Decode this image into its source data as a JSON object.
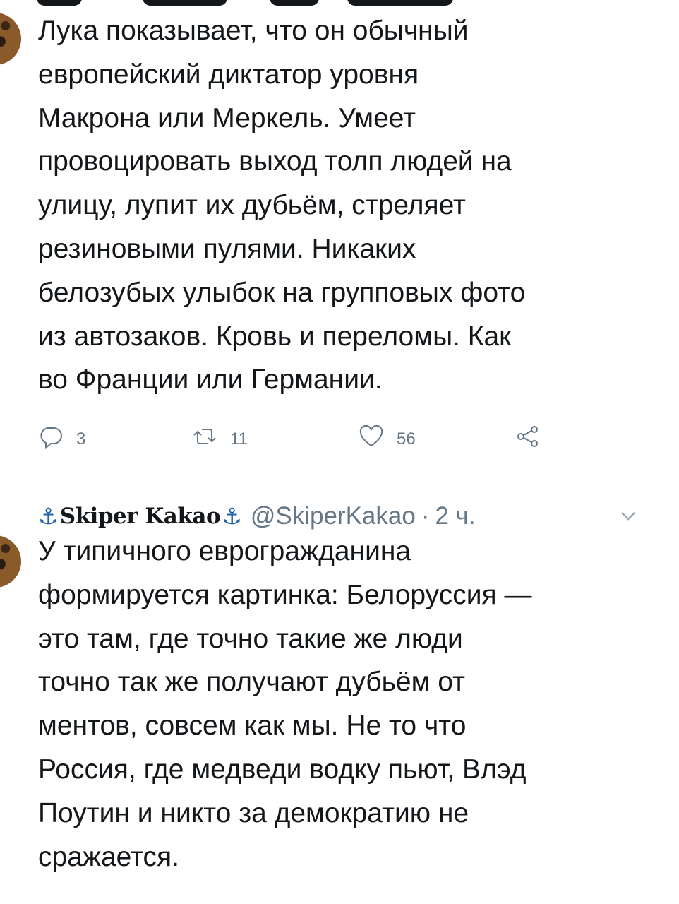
{
  "tweets": [
    {
      "text": "Лука показывает, что он обычный\nевропейский диктатор уровня\nМакрона или Меркель. Умеет\nпровоцировать выход толп людей на\nулицу, лупит их дубьём, стреляет\nрезиновыми пулями. Никаких\nбелозубых улыбок на групповых фото\nиз автозаков. Кровь и переломы. Как\nво Франции или Германии.",
      "replies": "3",
      "retweets": "11",
      "likes": "56"
    },
    {
      "anchor_left": "⚓",
      "display_name": "Skiper Kakao",
      "anchor_right": "⚓",
      "handle": "@SkiperKakao",
      "separator": "·",
      "time": "2 ч.",
      "text": "У типичного еврогражданина\nформируется картинка: Белоруссия —\nэто там, где точно такие же люди\nточно так же получают дубьём от\nментов, совсем как мы. Не то что\nРоссия, где медведи водку пьют, Влэд\nПоутин и никто за демократию не\nсражается."
    }
  ],
  "icons": {
    "reply": "reply-icon",
    "retweet": "retweet-icon",
    "like": "heart-icon",
    "share": "share-icon",
    "menu": "chevron-down-icon"
  },
  "colors": {
    "text": "#14171a",
    "muted": "#657786",
    "anchor": "#1d5fa8"
  }
}
